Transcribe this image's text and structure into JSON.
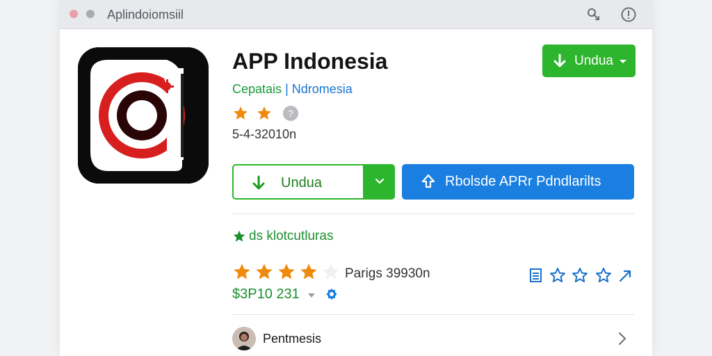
{
  "window": {
    "title": "Aplindoiomsiil"
  },
  "toolbar": {
    "share_icon": "share-icon",
    "info_icon": "info-icon"
  },
  "app": {
    "name": "APP Indonesia",
    "category": "Cepatais",
    "separator": "|",
    "publisher": "Ndromesia",
    "rating_stars_filled": 2,
    "version": "5-4-32010n"
  },
  "buttons": {
    "top_install_label": "Undua",
    "install_label": "Undua",
    "blue_label": "Rbolsde APRr Pdndlarilts"
  },
  "features": {
    "label": "ds klotcutluras"
  },
  "ratings": {
    "stars_filled": 4,
    "stars_total": 5,
    "count_label": "Parigs 39930n"
  },
  "price": {
    "label": "$3P10 231"
  },
  "developer": {
    "name": "Pentmesis"
  },
  "colors": {
    "green": "#2db52d",
    "blue": "#1a7fe0",
    "star_orange": "#f08a0c",
    "link_blue": "#1976d2"
  }
}
